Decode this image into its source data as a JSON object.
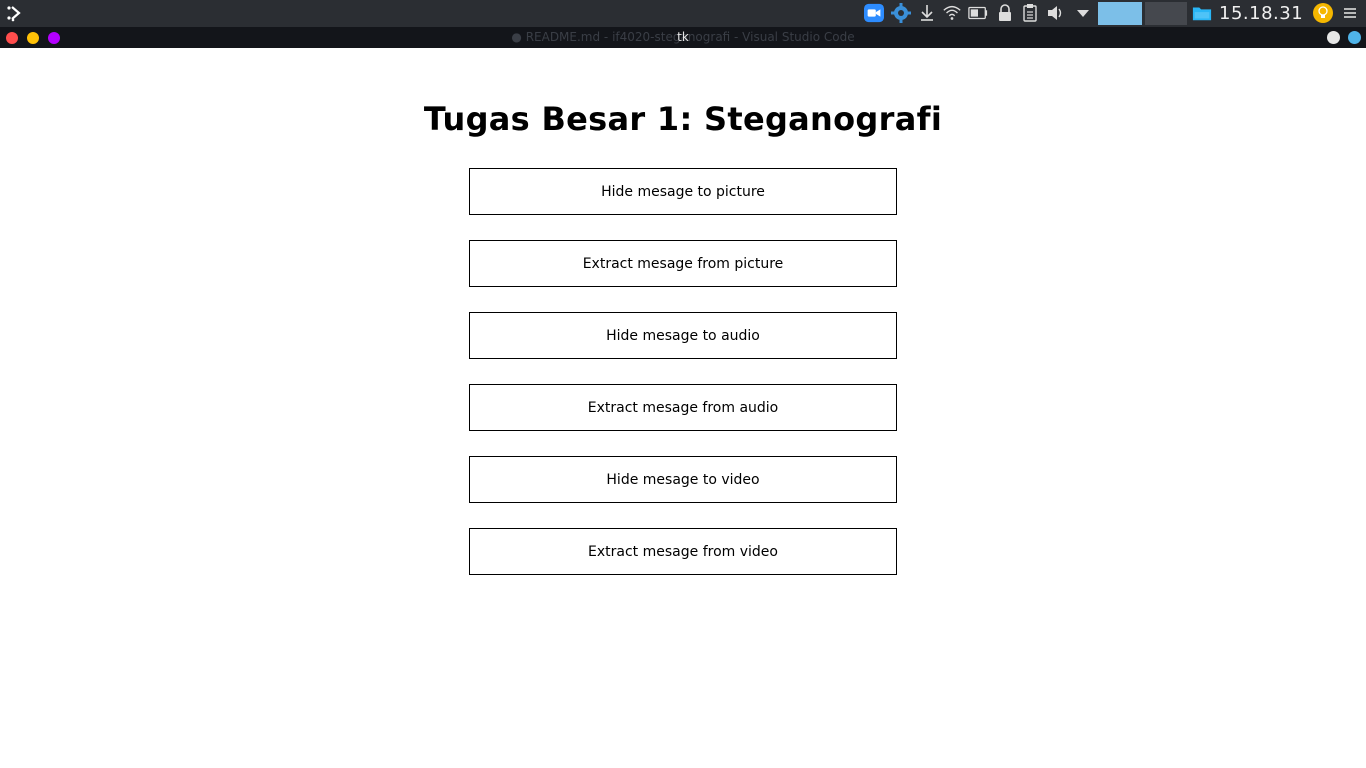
{
  "panel": {
    "clock": "15.18.31",
    "icons": [
      "launcher-icon",
      "zoom-video-icon",
      "settings-gear-icon",
      "download-icon",
      "wifi-icon",
      "battery-icon",
      "lock-icon",
      "clipboard-icon",
      "volume-icon",
      "dropdown-arrow-icon",
      "file-manager-icon",
      "notification-bulb-icon",
      "menu-icon"
    ],
    "colors": {
      "panel_bg": "#2b2e33",
      "workspace_active": "#7cbfe8",
      "workspace_inactive": "#45484e",
      "zoom_blue": "#2d8cff",
      "bulb_yellow": "#f5b700"
    }
  },
  "window": {
    "title": "tk",
    "background_title": "● README.md - if4020-steganografi - Visual Studio Code",
    "controls": {
      "close_color": "#ff4d4d",
      "minimize_color": "#ffc107",
      "maximize_color": "#b400ff"
    }
  },
  "app": {
    "heading": "Tugas Besar 1: Steganografi",
    "buttons": [
      "Hide mesage to picture",
      "Extract mesage from picture",
      "Hide mesage to audio",
      "Extract mesage from audio",
      "Hide mesage to video",
      "Extract mesage from video"
    ]
  }
}
